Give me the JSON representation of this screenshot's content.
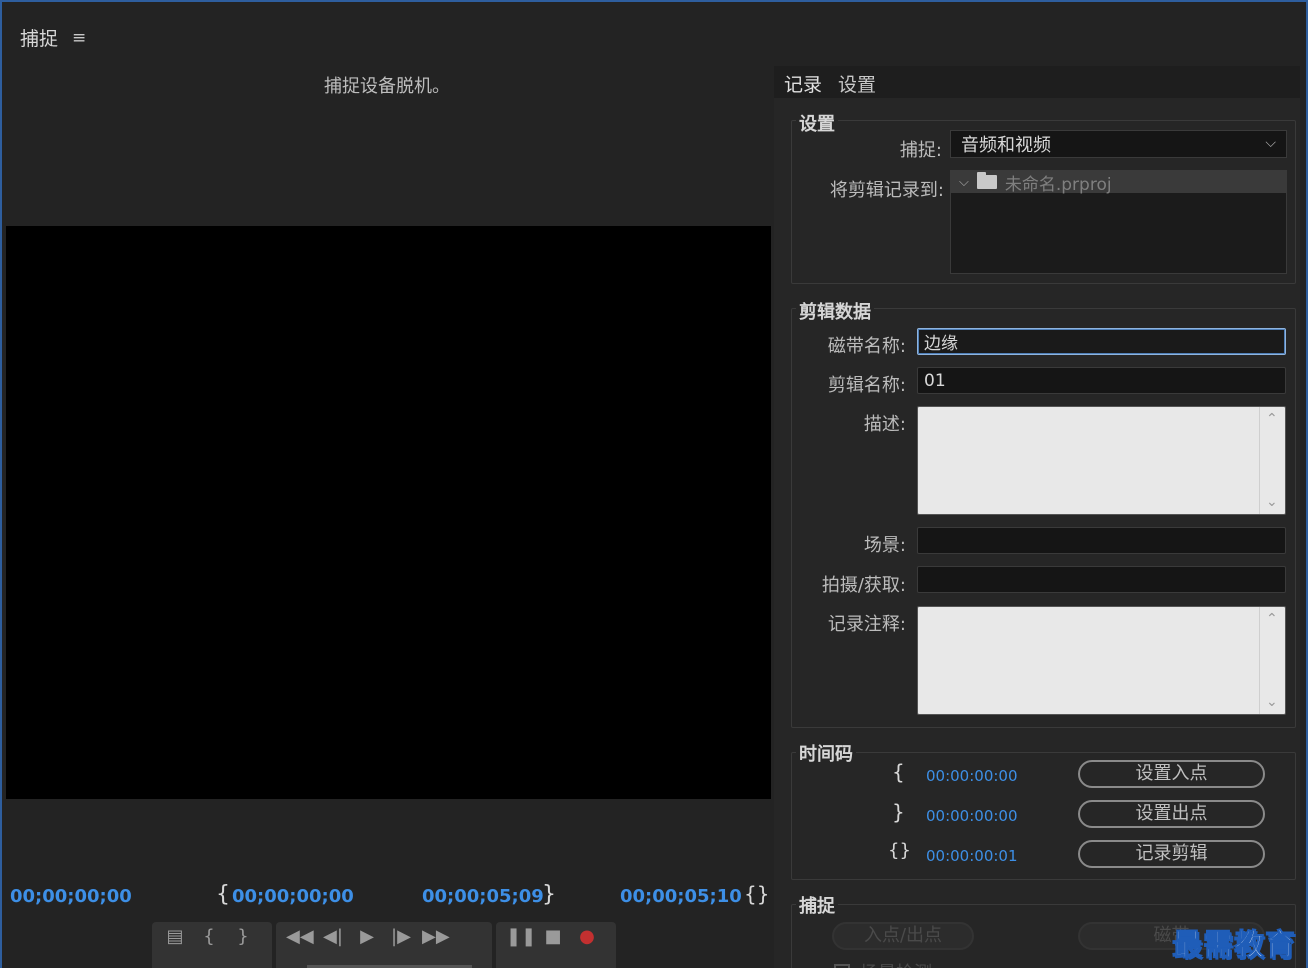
{
  "panel": {
    "title": "捕捉",
    "status": "捕捉设备脱机。"
  },
  "timecodes": {
    "current": "00;00;00;00",
    "in_point": "00;00;00;00",
    "out_point": "00;00;05;09",
    "duration": "00;00;05;10",
    "brace_open": "{",
    "brace_close": "}",
    "brace_pair": "{}"
  },
  "tabs": [
    {
      "label": "记录",
      "active": true
    },
    {
      "label": "设置",
      "active": false
    }
  ],
  "settings": {
    "title": "设置",
    "capture_label": "捕捉:",
    "capture_value": "音频和视频",
    "log_to_label": "将剪辑记录到:",
    "project_name": "未命名.prproj"
  },
  "clip_data": {
    "title": "剪辑数据",
    "tape_name_label": "磁带名称:",
    "tape_name_value": "边缘",
    "clip_name_label": "剪辑名称:",
    "clip_name_value": "01",
    "description_label": "描述:",
    "scene_label": "场景:",
    "shot_label": "拍摄/获取:",
    "log_note_label": "记录注释:"
  },
  "timecode_section": {
    "title": "时间码",
    "in_value": "00:00:00:00",
    "out_value": "00:00:00:00",
    "duration_value": "00:00:00:01",
    "set_in_label": "设置入点",
    "set_out_label": "设置出点",
    "log_clip_label": "记录剪辑"
  },
  "capture_section": {
    "title": "捕捉",
    "in_out_label": "入点/出点",
    "tape_label": "磁带",
    "scene_detect_label": "场景检测"
  },
  "watermark": "最需教育",
  "colors": {
    "accent": "#3d8fe6",
    "record": "#c23030",
    "background": "#232323"
  }
}
